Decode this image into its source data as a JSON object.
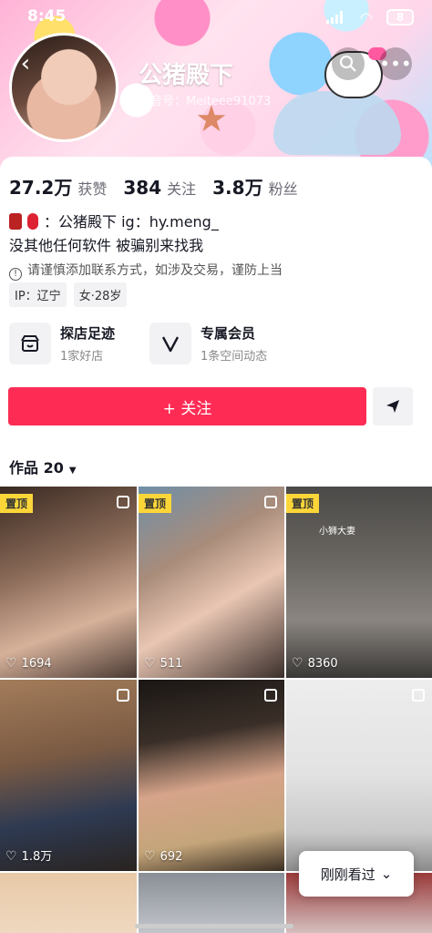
{
  "status_bar": {
    "time": "8:45",
    "battery": "8"
  },
  "header": {
    "name": "公猪殿下",
    "douyin_id": "抖音号：Meiteee91073"
  },
  "stats": [
    {
      "value": "27.2万",
      "label": "获赞"
    },
    {
      "value": "384",
      "label": "关注"
    },
    {
      "value": "3.8万",
      "label": "粉丝"
    }
  ],
  "bio": {
    "line1": "：公猪殿下  ig：hy.meng_",
    "line2": "没其他任何软件 被骗别来找我",
    "warning": "请谨慎添加联系方式，如涉及交易，谨防上当"
  },
  "tags": [
    "IP：辽宁",
    "女·28岁"
  ],
  "services": [
    {
      "title": "探店足迹",
      "sub": "1家好店",
      "icon": "shop-icon"
    },
    {
      "title": "专属会员",
      "sub": "1条空间动态",
      "icon": "v-icon"
    }
  ],
  "follow_label": "+ 关注",
  "works": {
    "label": "作品 20"
  },
  "grid": [
    {
      "pinned": "置顶",
      "likes": "1694"
    },
    {
      "pinned": "置顶",
      "likes": "511"
    },
    {
      "pinned": "置顶",
      "likes": "8360",
      "caption": "小狮大妻"
    },
    {
      "likes": "1.8万"
    },
    {
      "likes": "692"
    },
    {
      "likes": ""
    },
    {
      "likes": ""
    },
    {
      "likes": ""
    },
    {
      "likes": ""
    }
  ],
  "recent_label": "刚刚看过",
  "colors": {
    "accent": "#fe2c55",
    "pin": "#fcd639"
  }
}
